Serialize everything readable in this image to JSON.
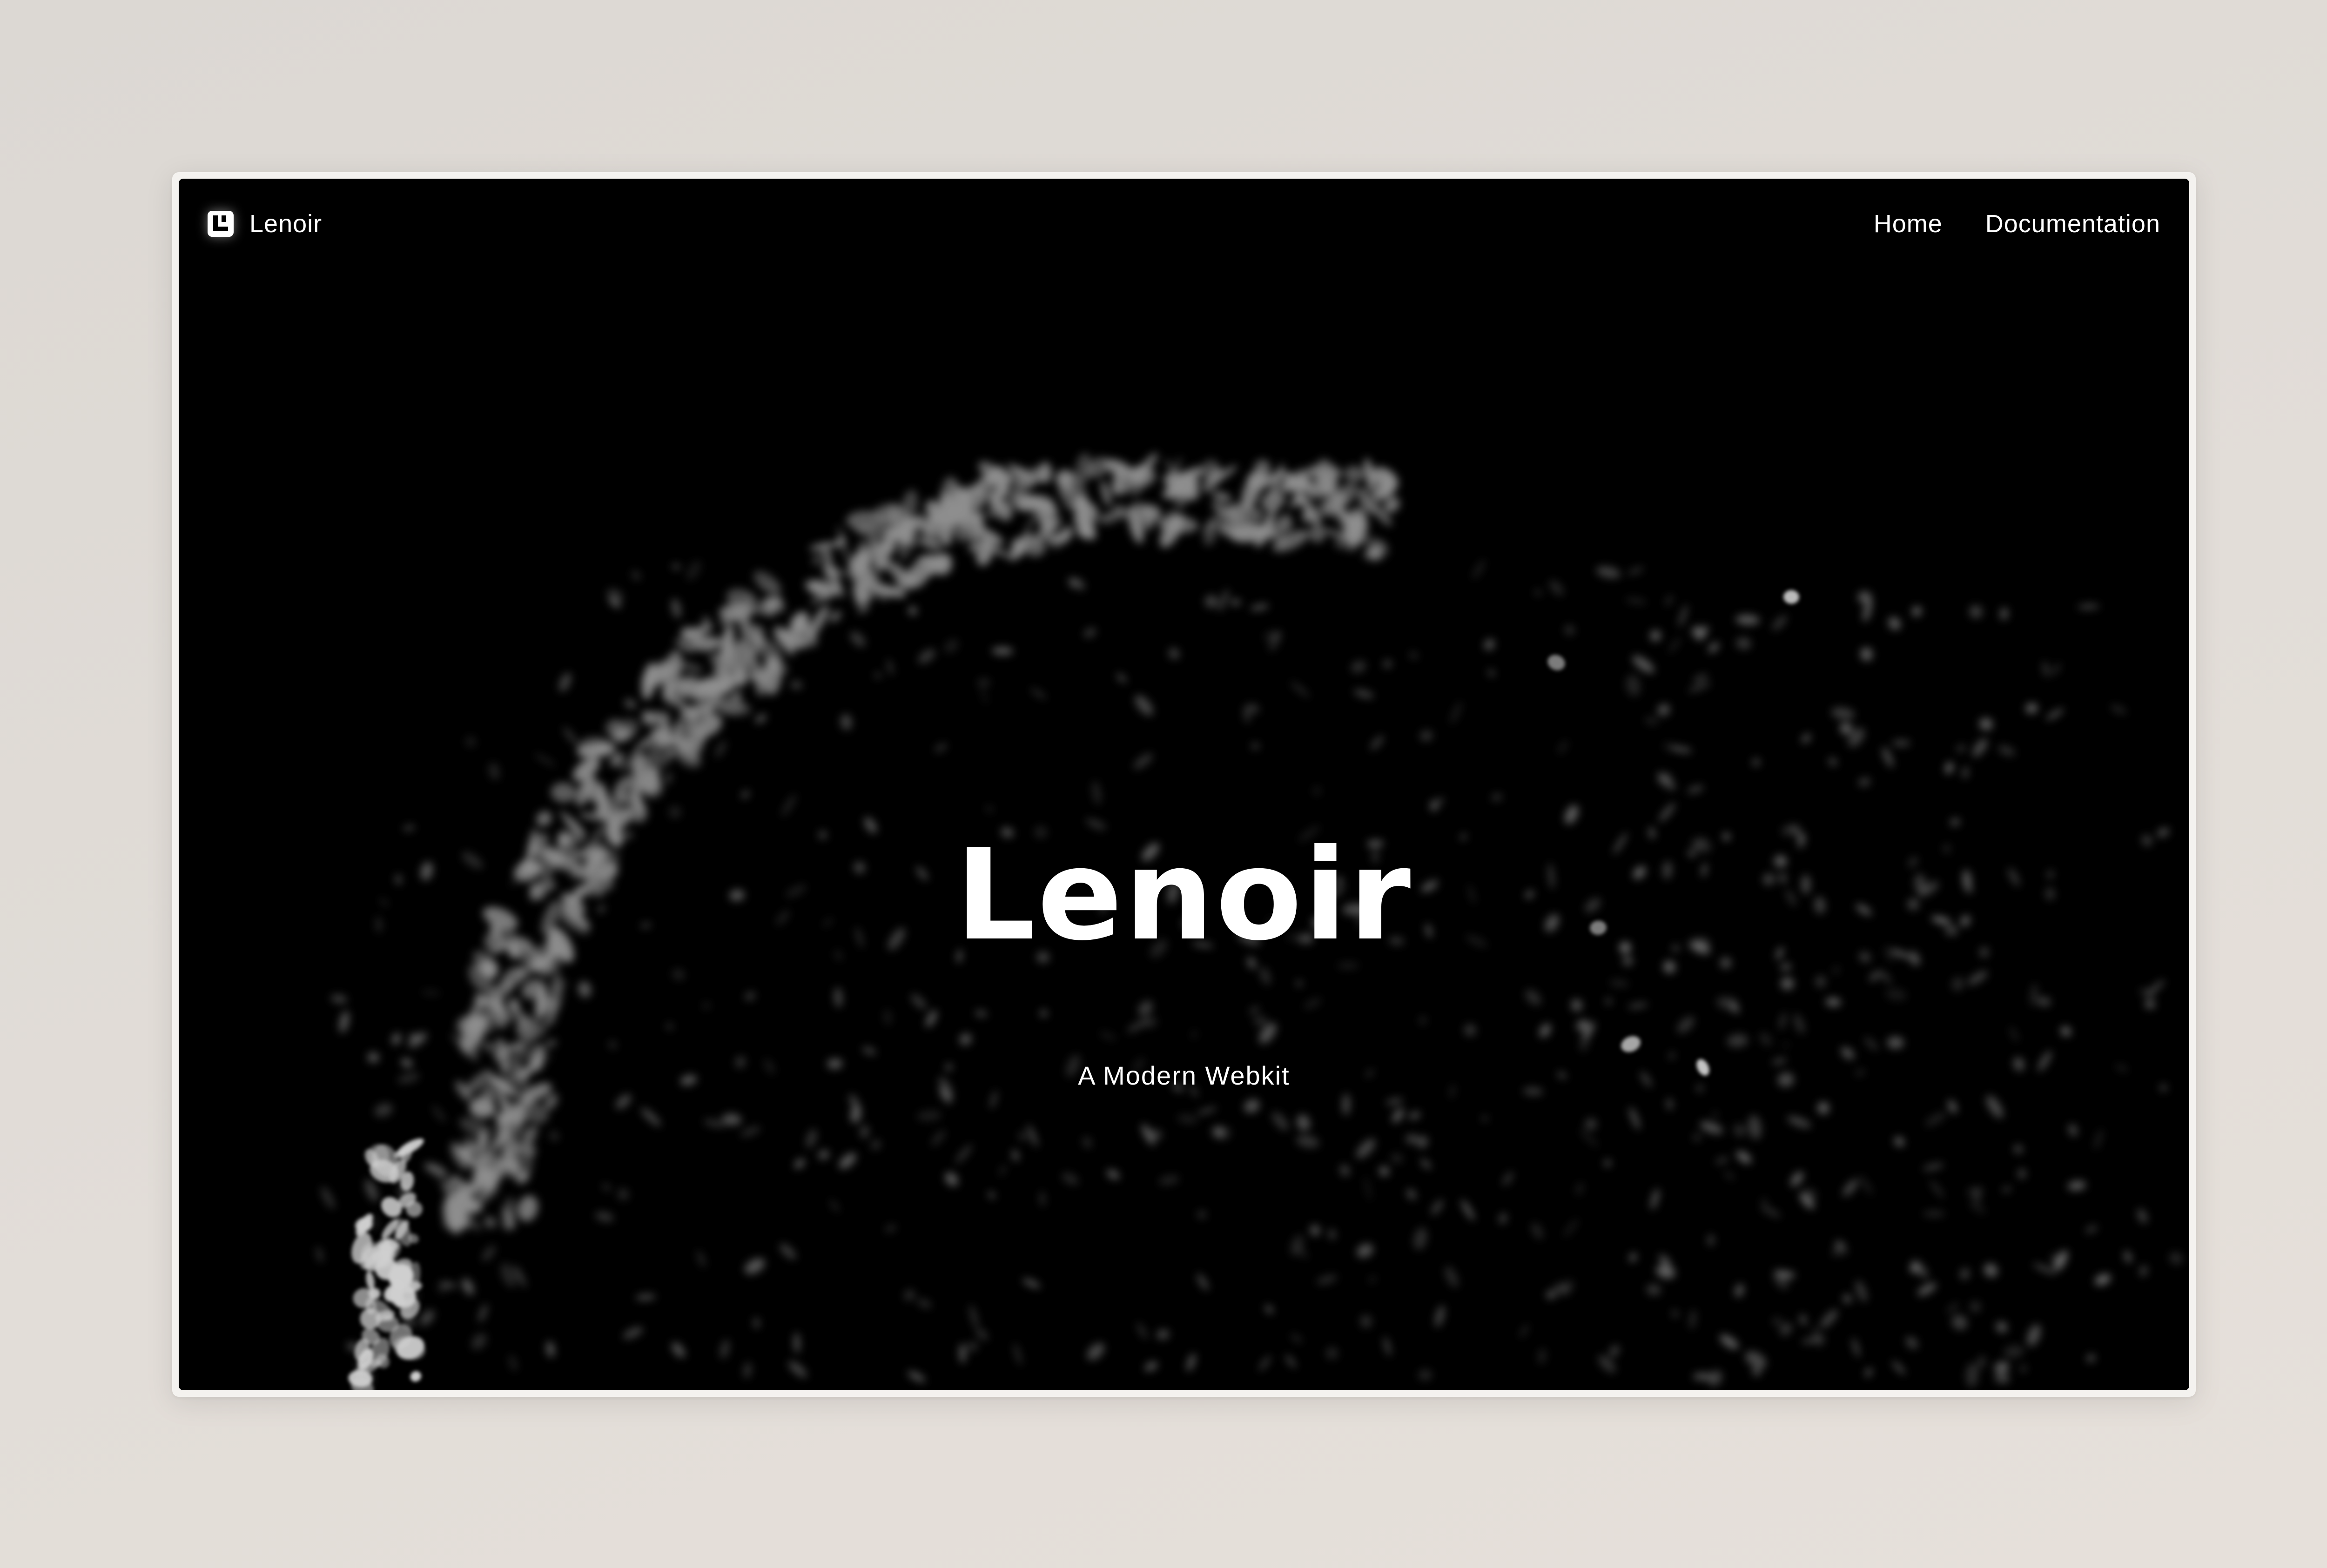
{
  "nav": {
    "brand_name": "Lenoir",
    "links": [
      {
        "label": "Home"
      },
      {
        "label": "Documentation"
      }
    ]
  },
  "hero": {
    "title": "Lenoir",
    "subtitle": "A Modern Webkit"
  },
  "colors": {
    "page_background": "#dcd8d3",
    "screen_background": "#000000",
    "text": "#ffffff"
  },
  "icons": {
    "brand_logo": "logo-icon"
  }
}
